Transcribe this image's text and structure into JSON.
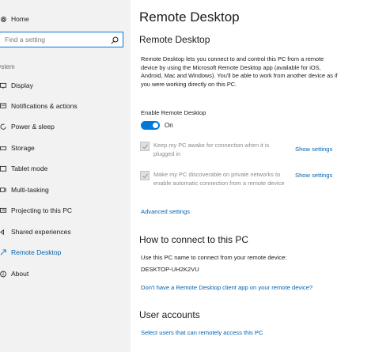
{
  "sidebar": {
    "home_label": "Home",
    "search_placeholder": "Find a setting",
    "section_label": "System",
    "items": [
      {
        "label": "Display",
        "icon": "display-icon"
      },
      {
        "label": "Notifications & actions",
        "icon": "notifications-icon"
      },
      {
        "label": "Power & sleep",
        "icon": "power-icon"
      },
      {
        "label": "Storage",
        "icon": "storage-icon"
      },
      {
        "label": "Tablet mode",
        "icon": "tablet-icon"
      },
      {
        "label": "Multi-tasking",
        "icon": "multitasking-icon"
      },
      {
        "label": "Projecting to this PC",
        "icon": "projecting-icon"
      },
      {
        "label": "Shared experiences",
        "icon": "shared-experiences-icon"
      },
      {
        "label": "Remote Desktop",
        "icon": "remote-desktop-icon",
        "active": true
      },
      {
        "label": "About",
        "icon": "info-icon"
      }
    ]
  },
  "main": {
    "page_title": "Remote Desktop",
    "section1_title": "Remote Desktop",
    "description": "Remote Desktop lets you connect to and control this PC from a remote device by using the Microsoft Remote Desktop app (available for iOS, Android, Mac and Windows). You'll be able to work from another device as if you were working directly on this PC.",
    "enable_label": "Enable Remote Desktop",
    "toggle_state": "On",
    "option1_label": "Keep my PC awake for connection when it is plugged in",
    "option2_label": "Make my PC discoverable on private networks to enable automatic connection from a remote device",
    "show_settings_label": "Show settings",
    "advanced_settings_link": "Advanced settings",
    "section2_title": "How to connect to this PC",
    "connect_instruction": "Use this PC name to connect from your remote device:",
    "pc_name": "DESKTOP-UH2K2VU",
    "client_app_link": "Don't have a Remote Desktop client app on your remote device?",
    "section3_title": "User accounts",
    "select_users_link": "Select users that can remotely access this PC"
  },
  "colors": {
    "accent": "#0078d7",
    "link": "#0063b1",
    "sidebar_bg": "#f2f2f2",
    "disabled_text": "#8a8a8a"
  }
}
